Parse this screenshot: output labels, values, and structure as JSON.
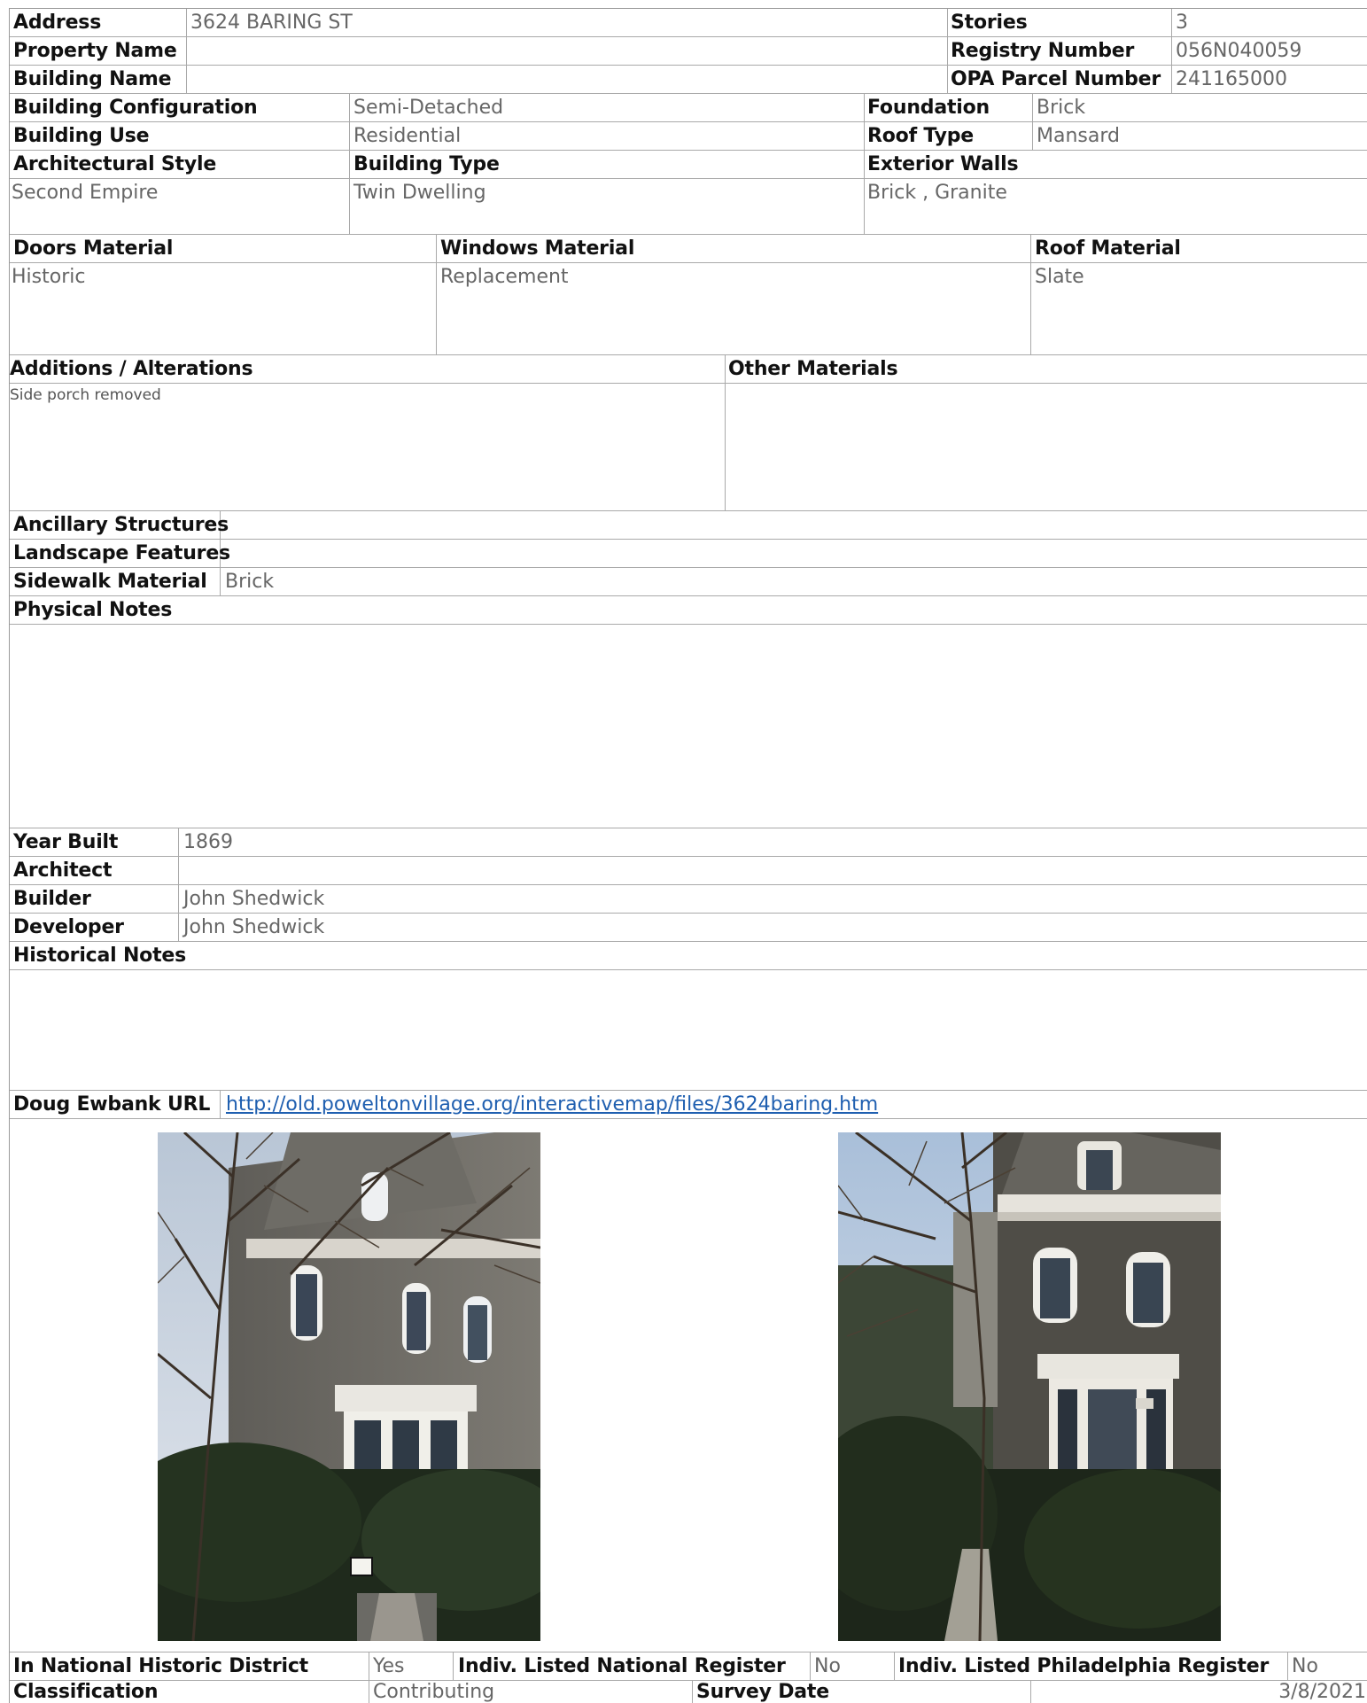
{
  "identity": {
    "address_label": "Address",
    "address_value": "3624 BARING ST",
    "property_name_label": "Property Name",
    "property_name_value": "",
    "building_name_label": "Building Name",
    "building_name_value": "",
    "stories_label": "Stories",
    "stories_value": "3",
    "registry_label": "Registry Number",
    "registry_value": "056N040059",
    "opa_label": "OPA Parcel Number",
    "opa_value": "241165000"
  },
  "building": {
    "config_label": "Building Configuration",
    "config_value": "Semi-Detached",
    "use_label": "Building Use",
    "use_value": "Residential",
    "foundation_label": "Foundation",
    "foundation_value": "Brick",
    "roof_type_label": "Roof Type",
    "roof_type_value": "Mansard",
    "arch_style_label": "Architectural Style",
    "arch_style_value": "Second Empire",
    "building_type_label": "Building Type",
    "building_type_value": "Twin Dwelling",
    "exterior_walls_label": "Exterior Walls",
    "exterior_walls_value": "Brick , Granite"
  },
  "materials": {
    "doors_label": "Doors Material",
    "doors_value": "Historic",
    "windows_label": "Windows Material",
    "windows_value": "Replacement",
    "roof_label": "Roof Material",
    "roof_value": "Slate"
  },
  "alterations": {
    "additions_label": "Additions / Alterations",
    "additions_value": "Side porch removed",
    "other_label": "Other Materials",
    "other_value": ""
  },
  "site": {
    "ancillary_label": "Ancillary Structures",
    "ancillary_value": "",
    "landscape_label": "Landscape Features",
    "landscape_value": "",
    "sidewalk_label": "Sidewalk Material",
    "sidewalk_value": "Brick",
    "physical_notes_label": "Physical Notes",
    "physical_notes_value": ""
  },
  "history": {
    "year_label": "Year Built",
    "year_value": "1869",
    "architect_label": "Architect",
    "architect_value": "",
    "builder_label": "Builder",
    "builder_value": "John Shedwick",
    "developer_label": "Developer",
    "developer_value": "John Shedwick",
    "notes_label": "Historical Notes",
    "notes_value": ""
  },
  "links": {
    "ewbank_label": "Doug Ewbank URL",
    "ewbank_url": "http://old.poweltonvillage.org/interactivemap/files/3624baring.htm"
  },
  "photos": [
    {
      "name": "front-facade-photo"
    },
    {
      "name": "side-facade-photo"
    }
  ],
  "status": {
    "district_label": "In National Historic District",
    "district_value": "Yes",
    "national_label": "Indiv. Listed National Register",
    "national_value": "No",
    "philly_label": "Indiv. Listed Philadelphia Register",
    "philly_value": "No",
    "classification_label": "Classification",
    "classification_value": "Contributing",
    "survey_label": "Survey Date",
    "survey_value": "3/8/2021"
  }
}
